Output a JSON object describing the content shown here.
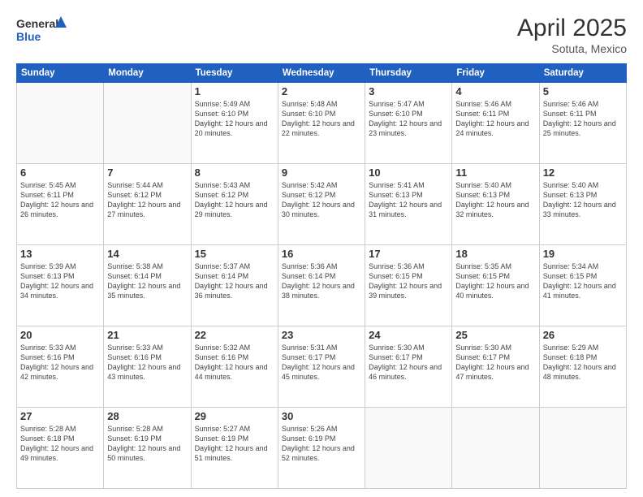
{
  "header": {
    "logo_general": "General",
    "logo_blue": "Blue",
    "month_title": "April 2025",
    "location": "Sotuta, Mexico"
  },
  "days_of_week": [
    "Sunday",
    "Monday",
    "Tuesday",
    "Wednesday",
    "Thursday",
    "Friday",
    "Saturday"
  ],
  "weeks": [
    [
      {
        "day": "",
        "info": ""
      },
      {
        "day": "",
        "info": ""
      },
      {
        "day": "1",
        "info": "Sunrise: 5:49 AM\nSunset: 6:10 PM\nDaylight: 12 hours and 20 minutes."
      },
      {
        "day": "2",
        "info": "Sunrise: 5:48 AM\nSunset: 6:10 PM\nDaylight: 12 hours and 22 minutes."
      },
      {
        "day": "3",
        "info": "Sunrise: 5:47 AM\nSunset: 6:10 PM\nDaylight: 12 hours and 23 minutes."
      },
      {
        "day": "4",
        "info": "Sunrise: 5:46 AM\nSunset: 6:11 PM\nDaylight: 12 hours and 24 minutes."
      },
      {
        "day": "5",
        "info": "Sunrise: 5:46 AM\nSunset: 6:11 PM\nDaylight: 12 hours and 25 minutes."
      }
    ],
    [
      {
        "day": "6",
        "info": "Sunrise: 5:45 AM\nSunset: 6:11 PM\nDaylight: 12 hours and 26 minutes."
      },
      {
        "day": "7",
        "info": "Sunrise: 5:44 AM\nSunset: 6:12 PM\nDaylight: 12 hours and 27 minutes."
      },
      {
        "day": "8",
        "info": "Sunrise: 5:43 AM\nSunset: 6:12 PM\nDaylight: 12 hours and 29 minutes."
      },
      {
        "day": "9",
        "info": "Sunrise: 5:42 AM\nSunset: 6:12 PM\nDaylight: 12 hours and 30 minutes."
      },
      {
        "day": "10",
        "info": "Sunrise: 5:41 AM\nSunset: 6:13 PM\nDaylight: 12 hours and 31 minutes."
      },
      {
        "day": "11",
        "info": "Sunrise: 5:40 AM\nSunset: 6:13 PM\nDaylight: 12 hours and 32 minutes."
      },
      {
        "day": "12",
        "info": "Sunrise: 5:40 AM\nSunset: 6:13 PM\nDaylight: 12 hours and 33 minutes."
      }
    ],
    [
      {
        "day": "13",
        "info": "Sunrise: 5:39 AM\nSunset: 6:13 PM\nDaylight: 12 hours and 34 minutes."
      },
      {
        "day": "14",
        "info": "Sunrise: 5:38 AM\nSunset: 6:14 PM\nDaylight: 12 hours and 35 minutes."
      },
      {
        "day": "15",
        "info": "Sunrise: 5:37 AM\nSunset: 6:14 PM\nDaylight: 12 hours and 36 minutes."
      },
      {
        "day": "16",
        "info": "Sunrise: 5:36 AM\nSunset: 6:14 PM\nDaylight: 12 hours and 38 minutes."
      },
      {
        "day": "17",
        "info": "Sunrise: 5:36 AM\nSunset: 6:15 PM\nDaylight: 12 hours and 39 minutes."
      },
      {
        "day": "18",
        "info": "Sunrise: 5:35 AM\nSunset: 6:15 PM\nDaylight: 12 hours and 40 minutes."
      },
      {
        "day": "19",
        "info": "Sunrise: 5:34 AM\nSunset: 6:15 PM\nDaylight: 12 hours and 41 minutes."
      }
    ],
    [
      {
        "day": "20",
        "info": "Sunrise: 5:33 AM\nSunset: 6:16 PM\nDaylight: 12 hours and 42 minutes."
      },
      {
        "day": "21",
        "info": "Sunrise: 5:33 AM\nSunset: 6:16 PM\nDaylight: 12 hours and 43 minutes."
      },
      {
        "day": "22",
        "info": "Sunrise: 5:32 AM\nSunset: 6:16 PM\nDaylight: 12 hours and 44 minutes."
      },
      {
        "day": "23",
        "info": "Sunrise: 5:31 AM\nSunset: 6:17 PM\nDaylight: 12 hours and 45 minutes."
      },
      {
        "day": "24",
        "info": "Sunrise: 5:30 AM\nSunset: 6:17 PM\nDaylight: 12 hours and 46 minutes."
      },
      {
        "day": "25",
        "info": "Sunrise: 5:30 AM\nSunset: 6:17 PM\nDaylight: 12 hours and 47 minutes."
      },
      {
        "day": "26",
        "info": "Sunrise: 5:29 AM\nSunset: 6:18 PM\nDaylight: 12 hours and 48 minutes."
      }
    ],
    [
      {
        "day": "27",
        "info": "Sunrise: 5:28 AM\nSunset: 6:18 PM\nDaylight: 12 hours and 49 minutes."
      },
      {
        "day": "28",
        "info": "Sunrise: 5:28 AM\nSunset: 6:19 PM\nDaylight: 12 hours and 50 minutes."
      },
      {
        "day": "29",
        "info": "Sunrise: 5:27 AM\nSunset: 6:19 PM\nDaylight: 12 hours and 51 minutes."
      },
      {
        "day": "30",
        "info": "Sunrise: 5:26 AM\nSunset: 6:19 PM\nDaylight: 12 hours and 52 minutes."
      },
      {
        "day": "",
        "info": ""
      },
      {
        "day": "",
        "info": ""
      },
      {
        "day": "",
        "info": ""
      }
    ]
  ]
}
